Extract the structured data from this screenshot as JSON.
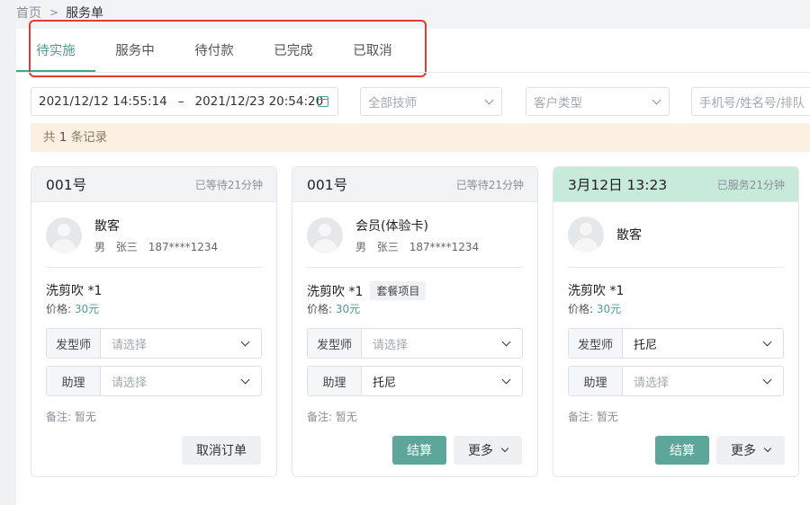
{
  "breadcrumb": {
    "home": "首页",
    "sep": ">",
    "current": "服务单"
  },
  "tabs": [
    {
      "label": "待实施",
      "active": true
    },
    {
      "label": "服务中",
      "active": false
    },
    {
      "label": "待付款",
      "active": false
    },
    {
      "label": "已完成",
      "active": false
    },
    {
      "label": "已取消",
      "active": false
    }
  ],
  "filters": {
    "date_start": "2021/12/12 14:55:14",
    "date_sep": "–",
    "date_end": "2021/12/23 20:54:20",
    "technician": "全部技师",
    "customer_type": "客户类型",
    "search_placeholder": "手机号/姓名号/排队"
  },
  "notice": {
    "prefix": "共",
    "count": "1",
    "suffix": "条记录"
  },
  "cards": [
    {
      "title": "001号",
      "status": "已等待21分钟",
      "customer_name": "散客",
      "gender": "男",
      "staff": "张三",
      "phone": "187****1234",
      "service": "洗剪吹 *1",
      "tag": "",
      "price_label": "价格:",
      "price": "30元",
      "stylist_label": "发型师",
      "stylist": "请选择",
      "assistant_label": "助理",
      "assistant": "请选择",
      "remark": "备注: 暂无",
      "btn1": "取消订单"
    },
    {
      "title": "001号",
      "status": "已等待21分钟",
      "customer_name": "会员(体验卡)",
      "gender": "男",
      "staff": "张三",
      "phone": "187****1234",
      "service": "洗剪吹 *1",
      "tag": "套餐项目",
      "price_label": "价格:",
      "price": "30元",
      "stylist_label": "发型师",
      "stylist": "请选择",
      "assistant_label": "助理",
      "assistant": "托尼",
      "remark": "备注: 暂无",
      "btn1": "结算",
      "btn2": "更多"
    },
    {
      "title": "3月12日 13:23",
      "status": "已服务21分钟",
      "customer_name": "散客",
      "service": "洗剪吹 *1",
      "tag": "",
      "price_label": "价格:",
      "price": "30元",
      "stylist_label": "发型师",
      "stylist": "托尼",
      "assistant_label": "助理",
      "assistant": "请选择",
      "remark": "备注: 暂无",
      "btn1": "结算",
      "btn2": "更多"
    }
  ],
  "colors": {
    "accent": "#4f9e92",
    "highlight": "#e23b36",
    "notice_bg": "#fbf0e1",
    "active_card_header": "#c7eadb"
  }
}
